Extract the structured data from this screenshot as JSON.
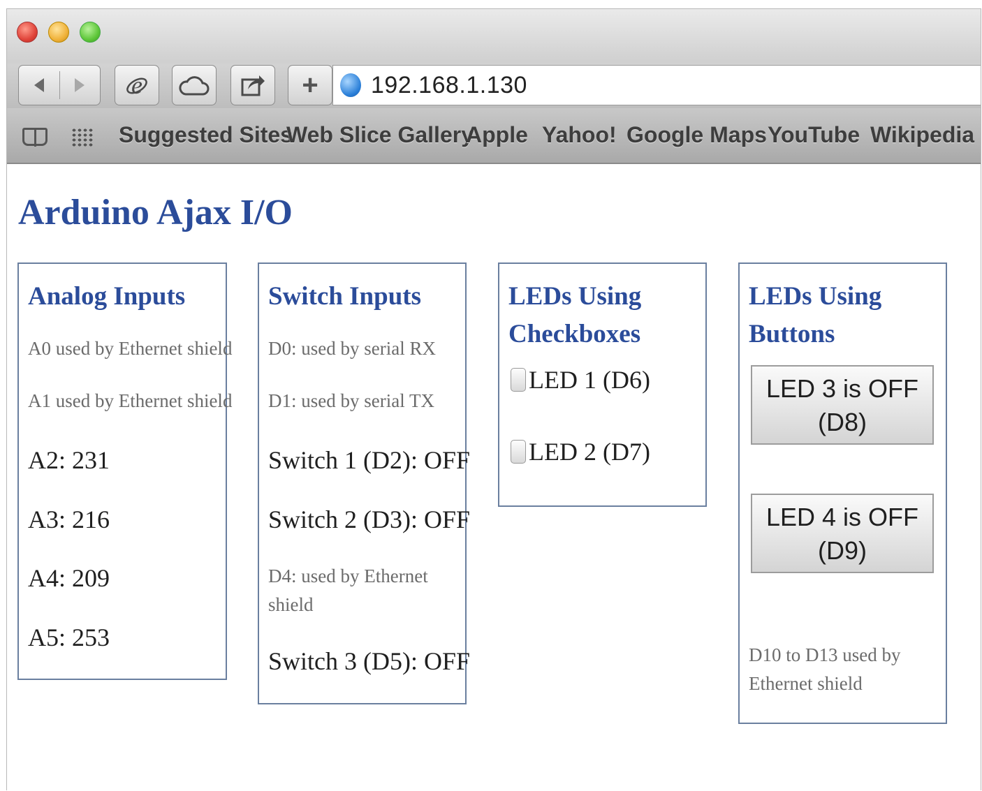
{
  "browser": {
    "url": "192.168.1.130",
    "bookmarks": [
      "Suggested Sites",
      "Web Slice Gallery",
      "Apple",
      "Yahoo!",
      "Google Maps",
      "YouTube",
      "Wikipedia"
    ]
  },
  "page": {
    "title": "Arduino Ajax I/O"
  },
  "analog": {
    "heading": "Analog Inputs",
    "a0": "A0 used by Ethernet shield",
    "a1": "A1 used by Ethernet shield",
    "a2": "A2: 231",
    "a3": "A3: 216",
    "a4": "A4: 209",
    "a5": "A5: 253"
  },
  "switches": {
    "heading": "Switch Inputs",
    "d0": "D0: used by serial RX",
    "d1": "D1: used by serial TX",
    "sw1": "Switch 1 (D2): OFF",
    "sw2": "Switch 2 (D3): OFF",
    "d4": "D4: used by Ethernet shield",
    "sw3": "Switch 3 (D5): OFF"
  },
  "led_checkboxes": {
    "heading": "LEDs Using Checkboxes",
    "led1": "LED 1 (D6)",
    "led2": "LED 2 (D7)"
  },
  "led_buttons": {
    "heading": "LEDs Using Buttons",
    "led3": "LED 3 is OFF (D8)",
    "led4": "LED 4 is OFF (D9)",
    "note": "D10 to D13 used by Ethernet shield"
  }
}
